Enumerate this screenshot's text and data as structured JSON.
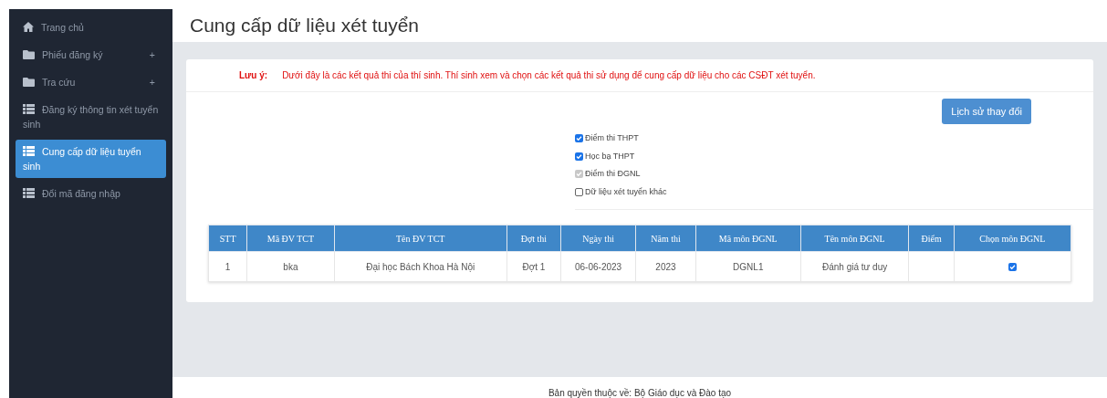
{
  "sidebar": {
    "items": [
      {
        "label": "Trang chủ",
        "kind": "home",
        "selected": false
      },
      {
        "label": "Phiếu đăng ký",
        "kind": "folder",
        "expand_sign": "+",
        "selected": false
      },
      {
        "label": "Tra cứu",
        "kind": "folder",
        "expand_sign": "+",
        "selected": false
      },
      {
        "label": "Đăng ký thông tin xét tuyển sinh",
        "kind": "list",
        "selected": false
      },
      {
        "label": "Cung cấp dữ liệu tuyển sinh",
        "kind": "list",
        "selected": true
      },
      {
        "label": "Đổi mã đăng nhập",
        "kind": "list",
        "selected": false
      }
    ]
  },
  "page_title": "Cung cấp dữ liệu xét tuyển",
  "notice": {
    "label": "Lưu ý:",
    "text": "Dưới đây là các kết quả thi của thí sinh. Thí sinh xem và chọn các kết quả thi sử dụng để cung cấp dữ liệu cho các CSĐT xét tuyển."
  },
  "history_button": "Lịch sử thay đổi",
  "options": [
    {
      "label": "Điểm thi THPT",
      "checked": true,
      "disabled": false
    },
    {
      "label": "Học bạ THPT",
      "checked": true,
      "disabled": false
    },
    {
      "label": "Điểm thi ĐGNL",
      "checked": true,
      "disabled": true
    },
    {
      "label": "Dữ liệu xét tuyển khác",
      "checked": false,
      "disabled": false
    }
  ],
  "table": {
    "columns": [
      "STT",
      "Mã ĐV TCT",
      "Tên ĐV TCT",
      "Đợt thi",
      "Ngày thi",
      "Năm thi",
      "Mã môn ĐGNL",
      "Tên môn ĐGNL",
      "Điểm",
      "Chọn môn ĐGNL"
    ],
    "rows": [
      {
        "cells": [
          "1",
          "bka",
          "Đại học Bách Khoa Hà Nội",
          "Đợt 1",
          "06-06-2023",
          "2023",
          "DGNL1",
          "Đánh giá tư duy",
          ""
        ],
        "selected": true
      }
    ]
  },
  "footer": "Bản quyền thuộc về: Bộ Giáo dục và Đào tạo"
}
